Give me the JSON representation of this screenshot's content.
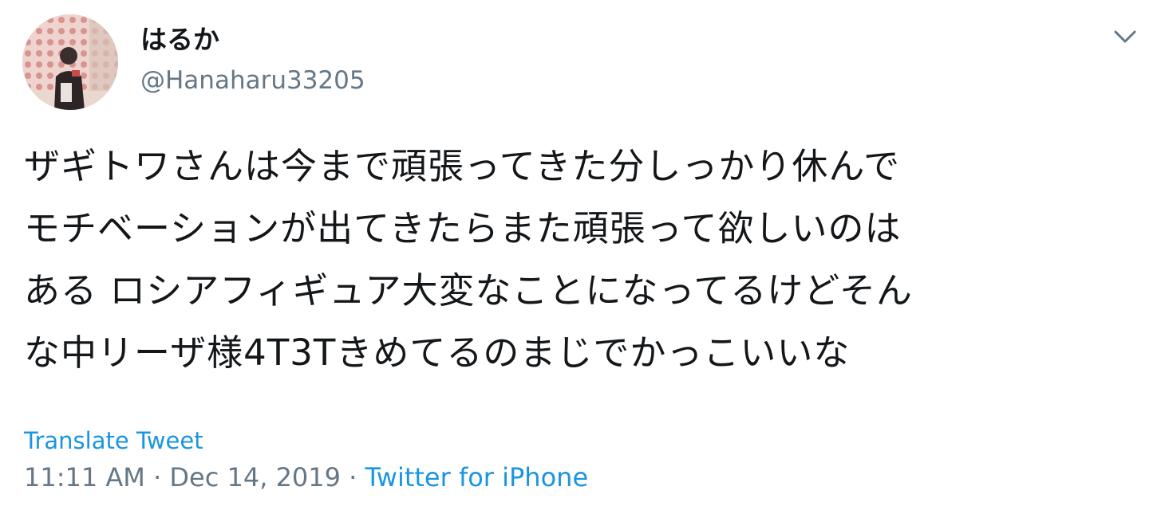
{
  "author": {
    "display_name": "はるか",
    "username": "@Hanaharu33205"
  },
  "tweet": {
    "text_lines": [
      "ザギトワさんは今まで頑張ってきた分しっかり休んで",
      "モチベーションが出てきたらまた頑張って欲しいのは",
      "ある ロシアフィギュア大変なことになってるけどそん",
      "な中リーザ様4T3Tきめてるのまじでかっこいいな"
    ],
    "translate_label": "Translate Tweet",
    "time": "11:11 AM",
    "separator": "·",
    "date": "Dec 14, 2019",
    "source": "Twitter for iPhone"
  },
  "icons": {
    "menu_caret": "chevron-down-icon",
    "avatar": "avatar"
  },
  "colors": {
    "text": "#14171a",
    "secondary_text": "#657786",
    "link": "#1b95e0"
  }
}
